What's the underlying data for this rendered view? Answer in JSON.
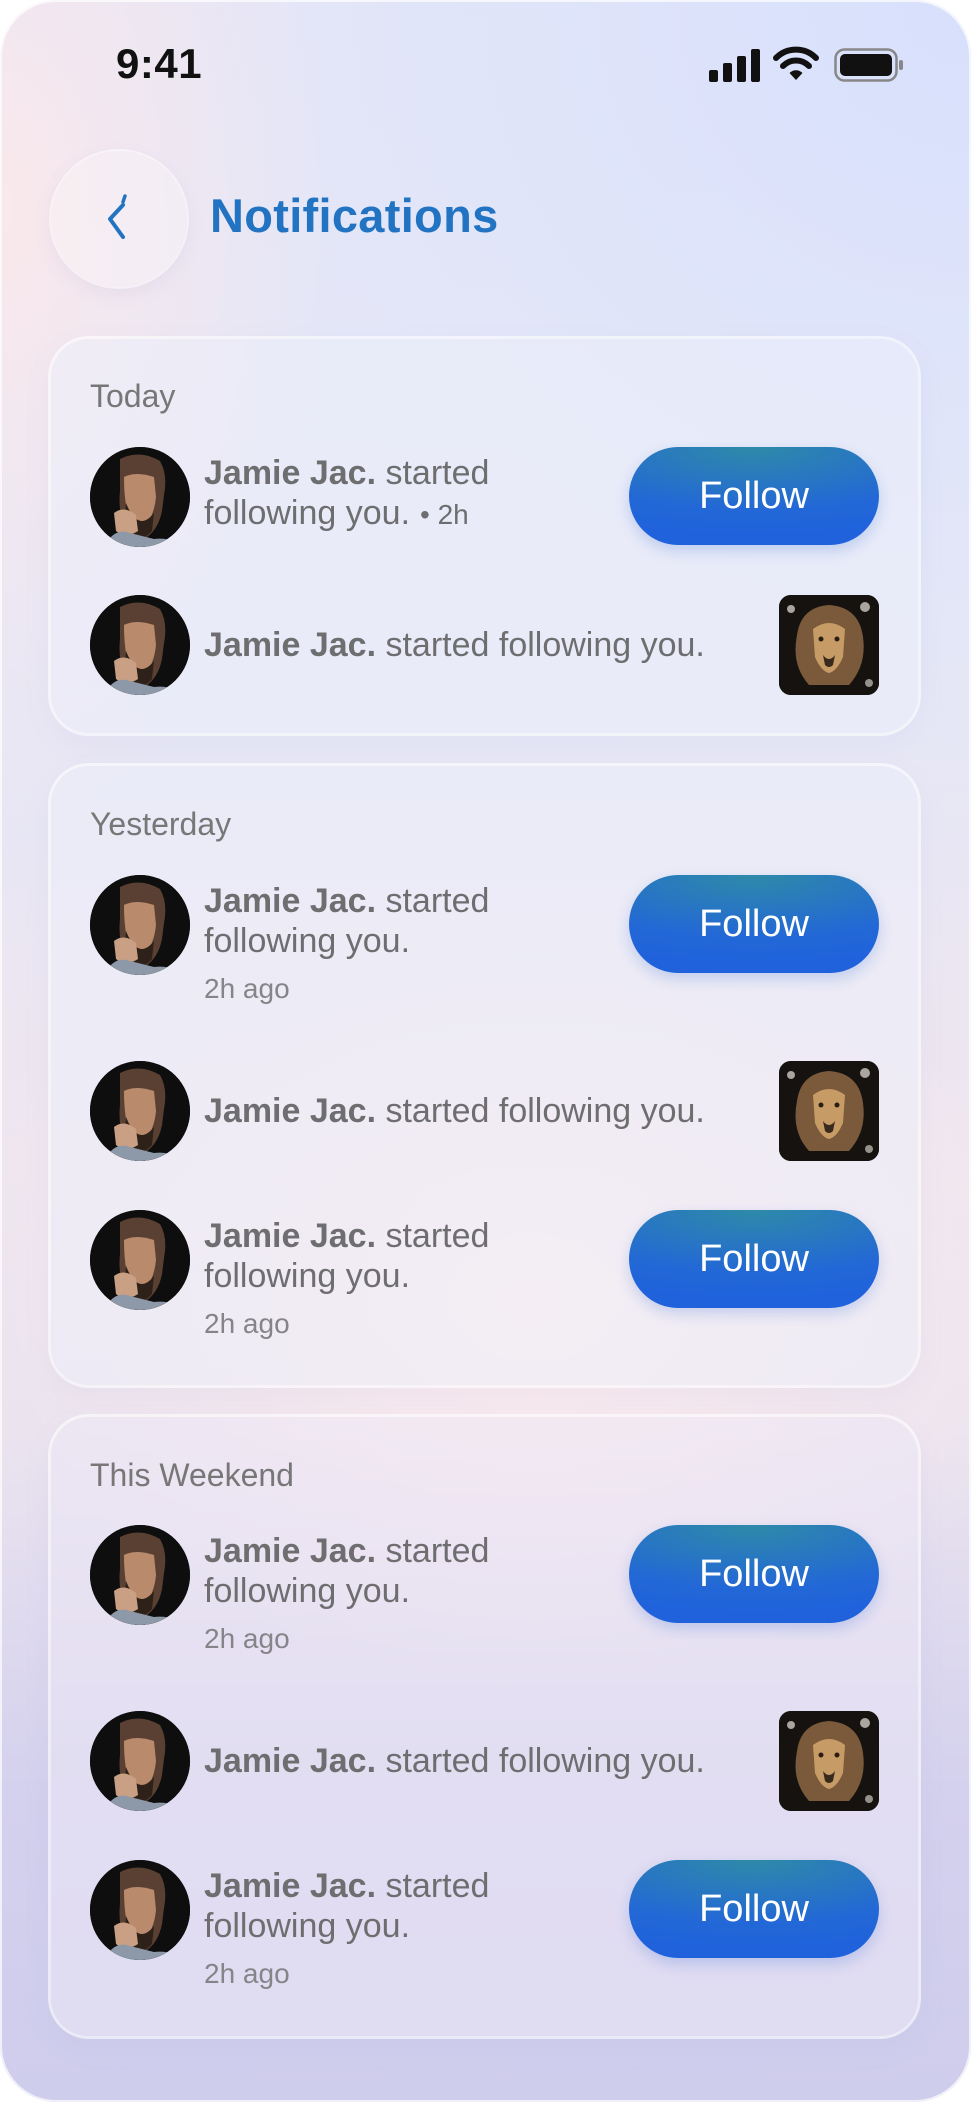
{
  "status_bar": {
    "time": "9:41"
  },
  "header": {
    "title": "Notifications"
  },
  "sections": [
    {
      "label": "Today",
      "items": [
        {
          "name": "Jamie Jac.",
          "text": "started",
          "text2": "following you.",
          "time": "• 2h"
        },
        {
          "name": "Jamie Jac.",
          "text": "started following you."
        }
      ]
    },
    {
      "label": "Yesterday",
      "items": [
        {
          "name": "Jamie Jac.",
          "text": "started",
          "text2": "following you.",
          "ago": "2h ago"
        },
        {
          "name": "Jamie Jac.",
          "text": "started following you."
        },
        {
          "name": "Jamie Jac.",
          "text": "started",
          "text2": "following you.",
          "ago": "2h ago"
        }
      ]
    },
    {
      "label": "This Weekend",
      "items": [
        {
          "name": "Jamie Jac.",
          "text": "started",
          "text2": "following you.",
          "ago": "2h ago"
        },
        {
          "name": "Jamie Jac.",
          "text": "started following you."
        },
        {
          "name": "Jamie Jac.",
          "text": "started",
          "text2": "following you.",
          "ago": "2h ago"
        }
      ]
    }
  ],
  "buttons": {
    "follow_label": "Follow"
  },
  "colors": {
    "accent": "#2274c2",
    "button": "#2368d6",
    "text": "#6e6e70"
  },
  "icons": {
    "back": "chevron-left-icon",
    "signal": "cellular-signal-icon",
    "wifi": "wifi-icon",
    "battery": "battery-icon"
  }
}
